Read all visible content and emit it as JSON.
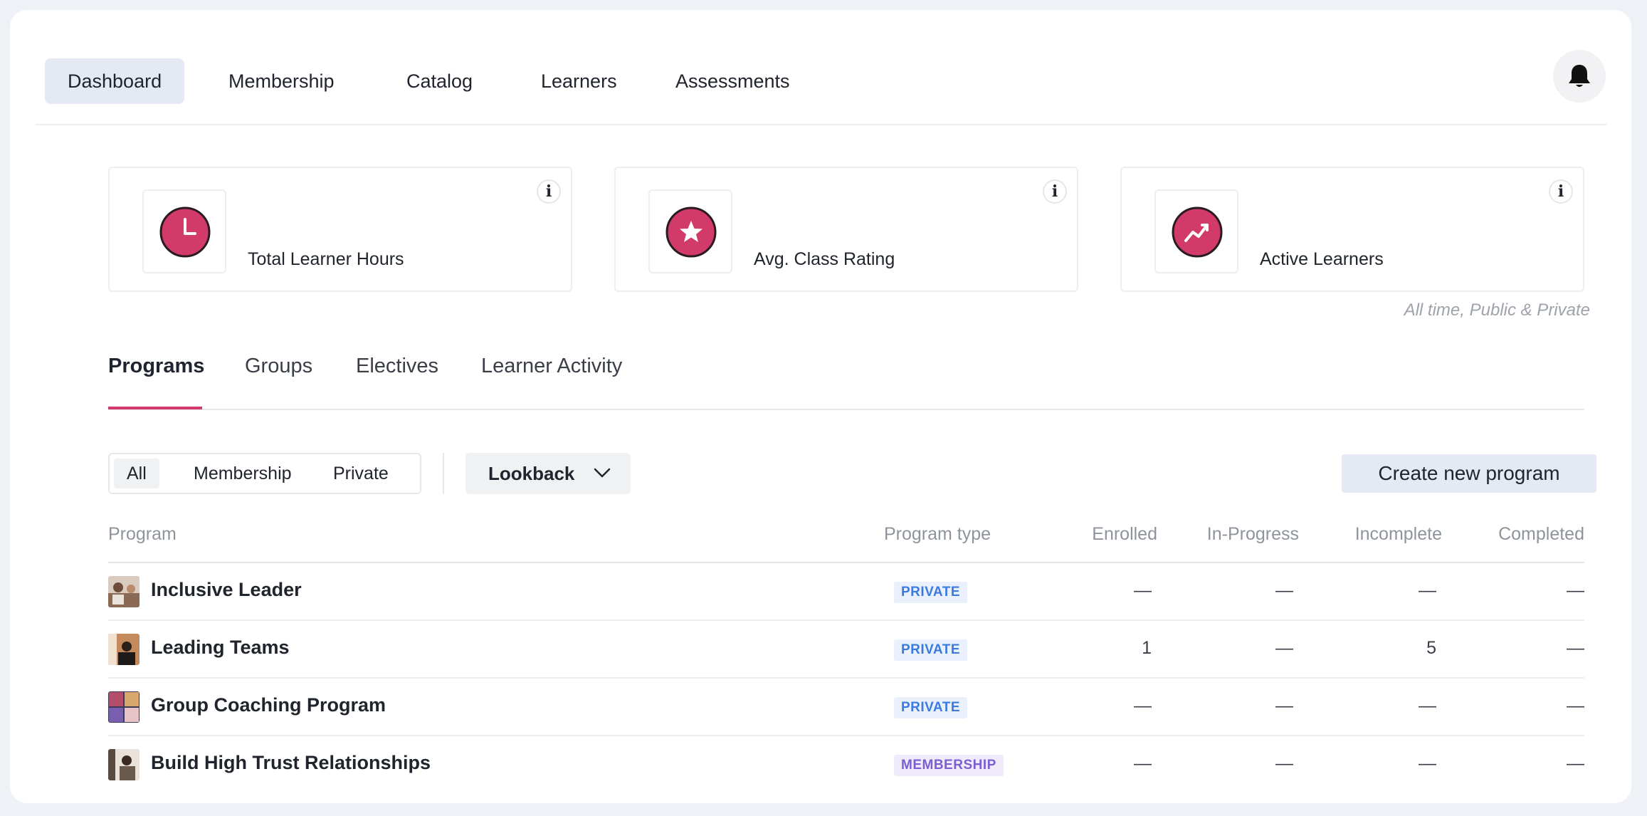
{
  "nav": {
    "items": [
      {
        "label": "Dashboard",
        "active": true
      },
      {
        "label": "Membership"
      },
      {
        "label": "Catalog"
      },
      {
        "label": "Learners"
      },
      {
        "label": "Assessments"
      }
    ],
    "bell_icon": "bell-icon"
  },
  "stats": [
    {
      "label": "Total Learner Hours",
      "icon": "clock-icon"
    },
    {
      "label": "Avg. Class Rating",
      "icon": "star-icon"
    },
    {
      "label": "Active Learners",
      "icon": "trend-up-icon"
    }
  ],
  "stats_caption": "All time, Public & Private",
  "accent_color": "#d23a6a",
  "tabs": [
    {
      "label": "Programs",
      "active": true
    },
    {
      "label": "Groups"
    },
    {
      "label": "Electives"
    },
    {
      "label": "Learner Activity"
    }
  ],
  "filters": {
    "segments": [
      "All",
      "Membership",
      "Private"
    ],
    "selected": "All",
    "lookback_label": "Lookback"
  },
  "create_button": "Create new program",
  "table": {
    "columns": [
      "Program",
      "Program type",
      "Enrolled",
      "In-Progress",
      "Incomplete",
      "Completed"
    ],
    "rows": [
      {
        "name": "Inclusive Leader",
        "type": "PRIVATE",
        "enrolled": "—",
        "in_progress": "—",
        "incomplete": "—",
        "completed": "—"
      },
      {
        "name": "Leading Teams",
        "type": "PRIVATE",
        "enrolled": "1",
        "in_progress": "—",
        "incomplete": "5",
        "completed": "—"
      },
      {
        "name": "Group Coaching Program",
        "type": "PRIVATE",
        "enrolled": "—",
        "in_progress": "—",
        "incomplete": "—",
        "completed": "—"
      },
      {
        "name": "Build High Trust Relationships",
        "type": "MEMBERSHIP",
        "enrolled": "—",
        "in_progress": "—",
        "incomplete": "—",
        "completed": "—"
      }
    ]
  }
}
